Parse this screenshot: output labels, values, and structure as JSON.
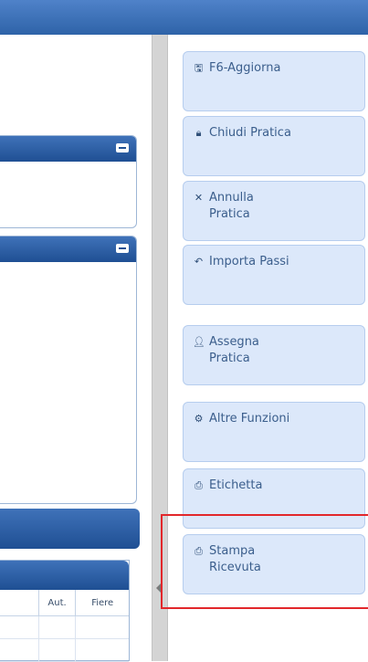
{
  "buttons": [
    {
      "id": "f6-aggiorna",
      "icon": "save-icon",
      "glyph": "🖫",
      "label": "F6-Aggiorna"
    },
    {
      "id": "chiudi-pratica",
      "icon": "lock-icon",
      "glyph": "🔒︎",
      "label": "Chiudi Pratica"
    },
    {
      "id": "annulla-pratica",
      "icon": "close-icon",
      "glyph": "✕",
      "label": "Annulla Pratica"
    },
    {
      "id": "importa-passi",
      "icon": "undo-icon",
      "glyph": "↶",
      "label": "Importa Passi"
    },
    {
      "id": "assegna-pratica",
      "icon": "user-icon",
      "glyph": "👤︎",
      "label": "Assegna Pratica"
    },
    {
      "id": "altre-funzioni",
      "icon": "gear-icon",
      "glyph": "⚙",
      "label": "Altre Funzioni"
    },
    {
      "id": "etichetta",
      "icon": "printer-icon",
      "glyph": "⎙",
      "label": "Etichetta"
    },
    {
      "id": "stampa-ricevuta",
      "icon": "printer-icon",
      "glyph": "⎙",
      "label": "Stampa Ricevuta"
    }
  ],
  "table": {
    "columns": [
      "Aut.",
      "Fiere"
    ]
  },
  "colors": {
    "header": "#2e63a8",
    "button_bg": "#dce8fa",
    "highlight": "#e2272b"
  }
}
